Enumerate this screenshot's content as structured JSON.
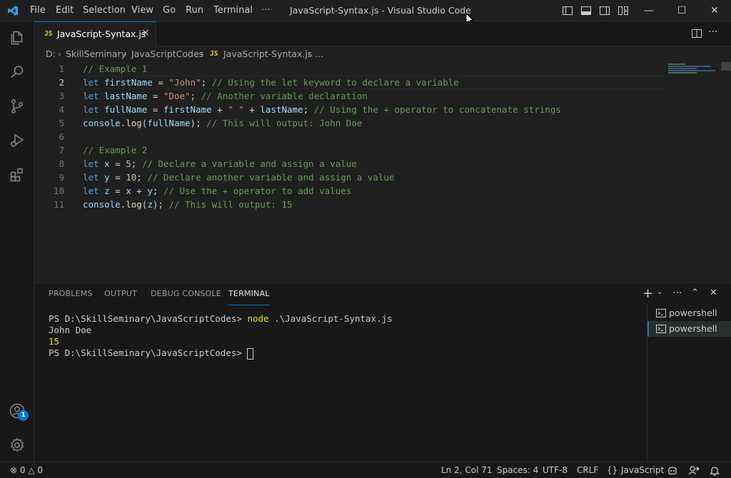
{
  "colors": {
    "accent": "#0078d4",
    "background": "#1f1f1f",
    "jsBadge": "#e8c547",
    "badge": "#0078d4"
  },
  "titlebar": {
    "menu": [
      "File",
      "Edit",
      "Selection",
      "View",
      "Go",
      "Run",
      "Terminal",
      "···"
    ],
    "window_title": "JavaScript-Syntax.js - Visual Studio Code",
    "controls": [
      "minimize-icon",
      "maximize-icon",
      "close-icon"
    ]
  },
  "activity_bar": {
    "items": [
      "explorer-icon",
      "search-icon",
      "source-control-icon",
      "run-debug-icon",
      "extensions-icon"
    ],
    "bottom": [
      "accounts-icon",
      "settings-gear-icon"
    ],
    "accounts_badge": "1"
  },
  "tabs": [
    {
      "badge": "JS",
      "label": "JavaScript-Syntax.js",
      "close": "×"
    }
  ],
  "breadcrumb": {
    "drive": "D:",
    "folder1": "SkillSeminary",
    "folder2": "JavaScriptCodes",
    "badge": "JS",
    "file": "JavaScript-Syntax.js",
    "more": "..."
  },
  "editor": {
    "line_numbers": [
      "1",
      "2",
      "3",
      "4",
      "5",
      "6",
      "7",
      "8",
      "9",
      "10",
      "11"
    ],
    "active_line": 2,
    "lines": [
      [
        {
          "t": "cm",
          "v": "// Example 1"
        }
      ],
      [
        {
          "t": "kw",
          "v": "let"
        },
        {
          "t": "op",
          "v": " "
        },
        {
          "t": "var",
          "v": "firstName"
        },
        {
          "t": "op",
          "v": " = "
        },
        {
          "t": "str",
          "v": "\"John\""
        },
        {
          "t": "punc",
          "v": "; "
        },
        {
          "t": "cm",
          "v": "// Using the let keyword to declare a variable"
        }
      ],
      [
        {
          "t": "kw",
          "v": "let"
        },
        {
          "t": "op",
          "v": " "
        },
        {
          "t": "var",
          "v": "lastName"
        },
        {
          "t": "op",
          "v": " = "
        },
        {
          "t": "str",
          "v": "\"Doe\""
        },
        {
          "t": "punc",
          "v": "; "
        },
        {
          "t": "cm",
          "v": "// Another variable declaration"
        }
      ],
      [
        {
          "t": "kw",
          "v": "let"
        },
        {
          "t": "op",
          "v": " "
        },
        {
          "t": "var",
          "v": "fullName"
        },
        {
          "t": "op",
          "v": " = "
        },
        {
          "t": "var",
          "v": "firstName"
        },
        {
          "t": "op",
          "v": " + "
        },
        {
          "t": "str",
          "v": "\" \""
        },
        {
          "t": "op",
          "v": " + "
        },
        {
          "t": "var",
          "v": "lastName"
        },
        {
          "t": "punc",
          "v": "; "
        },
        {
          "t": "cm",
          "v": "// Using the + operator to concatenate strings"
        }
      ],
      [
        {
          "t": "var",
          "v": "console"
        },
        {
          "t": "punc",
          "v": "."
        },
        {
          "t": "fn",
          "v": "log"
        },
        {
          "t": "punc",
          "v": "("
        },
        {
          "t": "var",
          "v": "fullName"
        },
        {
          "t": "punc",
          "v": "); "
        },
        {
          "t": "cm",
          "v": "// This will output: John Doe"
        }
      ],
      [],
      [
        {
          "t": "cm",
          "v": "// Example 2"
        }
      ],
      [
        {
          "t": "kw",
          "v": "let"
        },
        {
          "t": "op",
          "v": " "
        },
        {
          "t": "var",
          "v": "x"
        },
        {
          "t": "op",
          "v": " = "
        },
        {
          "t": "num",
          "v": "5"
        },
        {
          "t": "punc",
          "v": "; "
        },
        {
          "t": "cm",
          "v": "// Declare a variable and assign a value"
        }
      ],
      [
        {
          "t": "kw",
          "v": "let"
        },
        {
          "t": "op",
          "v": " "
        },
        {
          "t": "var",
          "v": "y"
        },
        {
          "t": "op",
          "v": " = "
        },
        {
          "t": "num",
          "v": "10"
        },
        {
          "t": "punc",
          "v": "; "
        },
        {
          "t": "cm",
          "v": "// Declare another variable and assign a value"
        }
      ],
      [
        {
          "t": "kw",
          "v": "let"
        },
        {
          "t": "op",
          "v": " "
        },
        {
          "t": "var",
          "v": "z"
        },
        {
          "t": "op",
          "v": " = "
        },
        {
          "t": "var",
          "v": "x"
        },
        {
          "t": "op",
          "v": " + "
        },
        {
          "t": "var",
          "v": "y"
        },
        {
          "t": "punc",
          "v": "; "
        },
        {
          "t": "cm",
          "v": "// Use the + operator to add values"
        }
      ],
      [
        {
          "t": "var",
          "v": "console"
        },
        {
          "t": "punc",
          "v": "."
        },
        {
          "t": "fn",
          "v": "log"
        },
        {
          "t": "punc",
          "v": "("
        },
        {
          "t": "var",
          "v": "z"
        },
        {
          "t": "punc",
          "v": "); "
        },
        {
          "t": "cm",
          "v": "// This will output: 15"
        }
      ]
    ]
  },
  "panel": {
    "tabs": [
      "PROBLEMS",
      "OUTPUT",
      "DEBUG CONSOLE",
      "TERMINAL"
    ],
    "active_tab": "TERMINAL",
    "terminal": {
      "prompt1": "PS D:\\SkillSeminary\\JavaScriptCodes> ",
      "cmd": "node",
      "arg": " .\\JavaScript-Syntax.js",
      "out1": "John Doe",
      "out2": "15",
      "prompt2": "PS D:\\SkillSeminary\\JavaScriptCodes> "
    },
    "terminals": [
      "powershell",
      "powershell"
    ]
  },
  "statusbar": {
    "errors": "0",
    "warnings": "0",
    "position": "Ln 2, Col 71",
    "spaces": "Spaces: 4",
    "encoding": "UTF-8",
    "eol": "CRLF",
    "lang_braces": "{}",
    "language": "JavaScript"
  }
}
